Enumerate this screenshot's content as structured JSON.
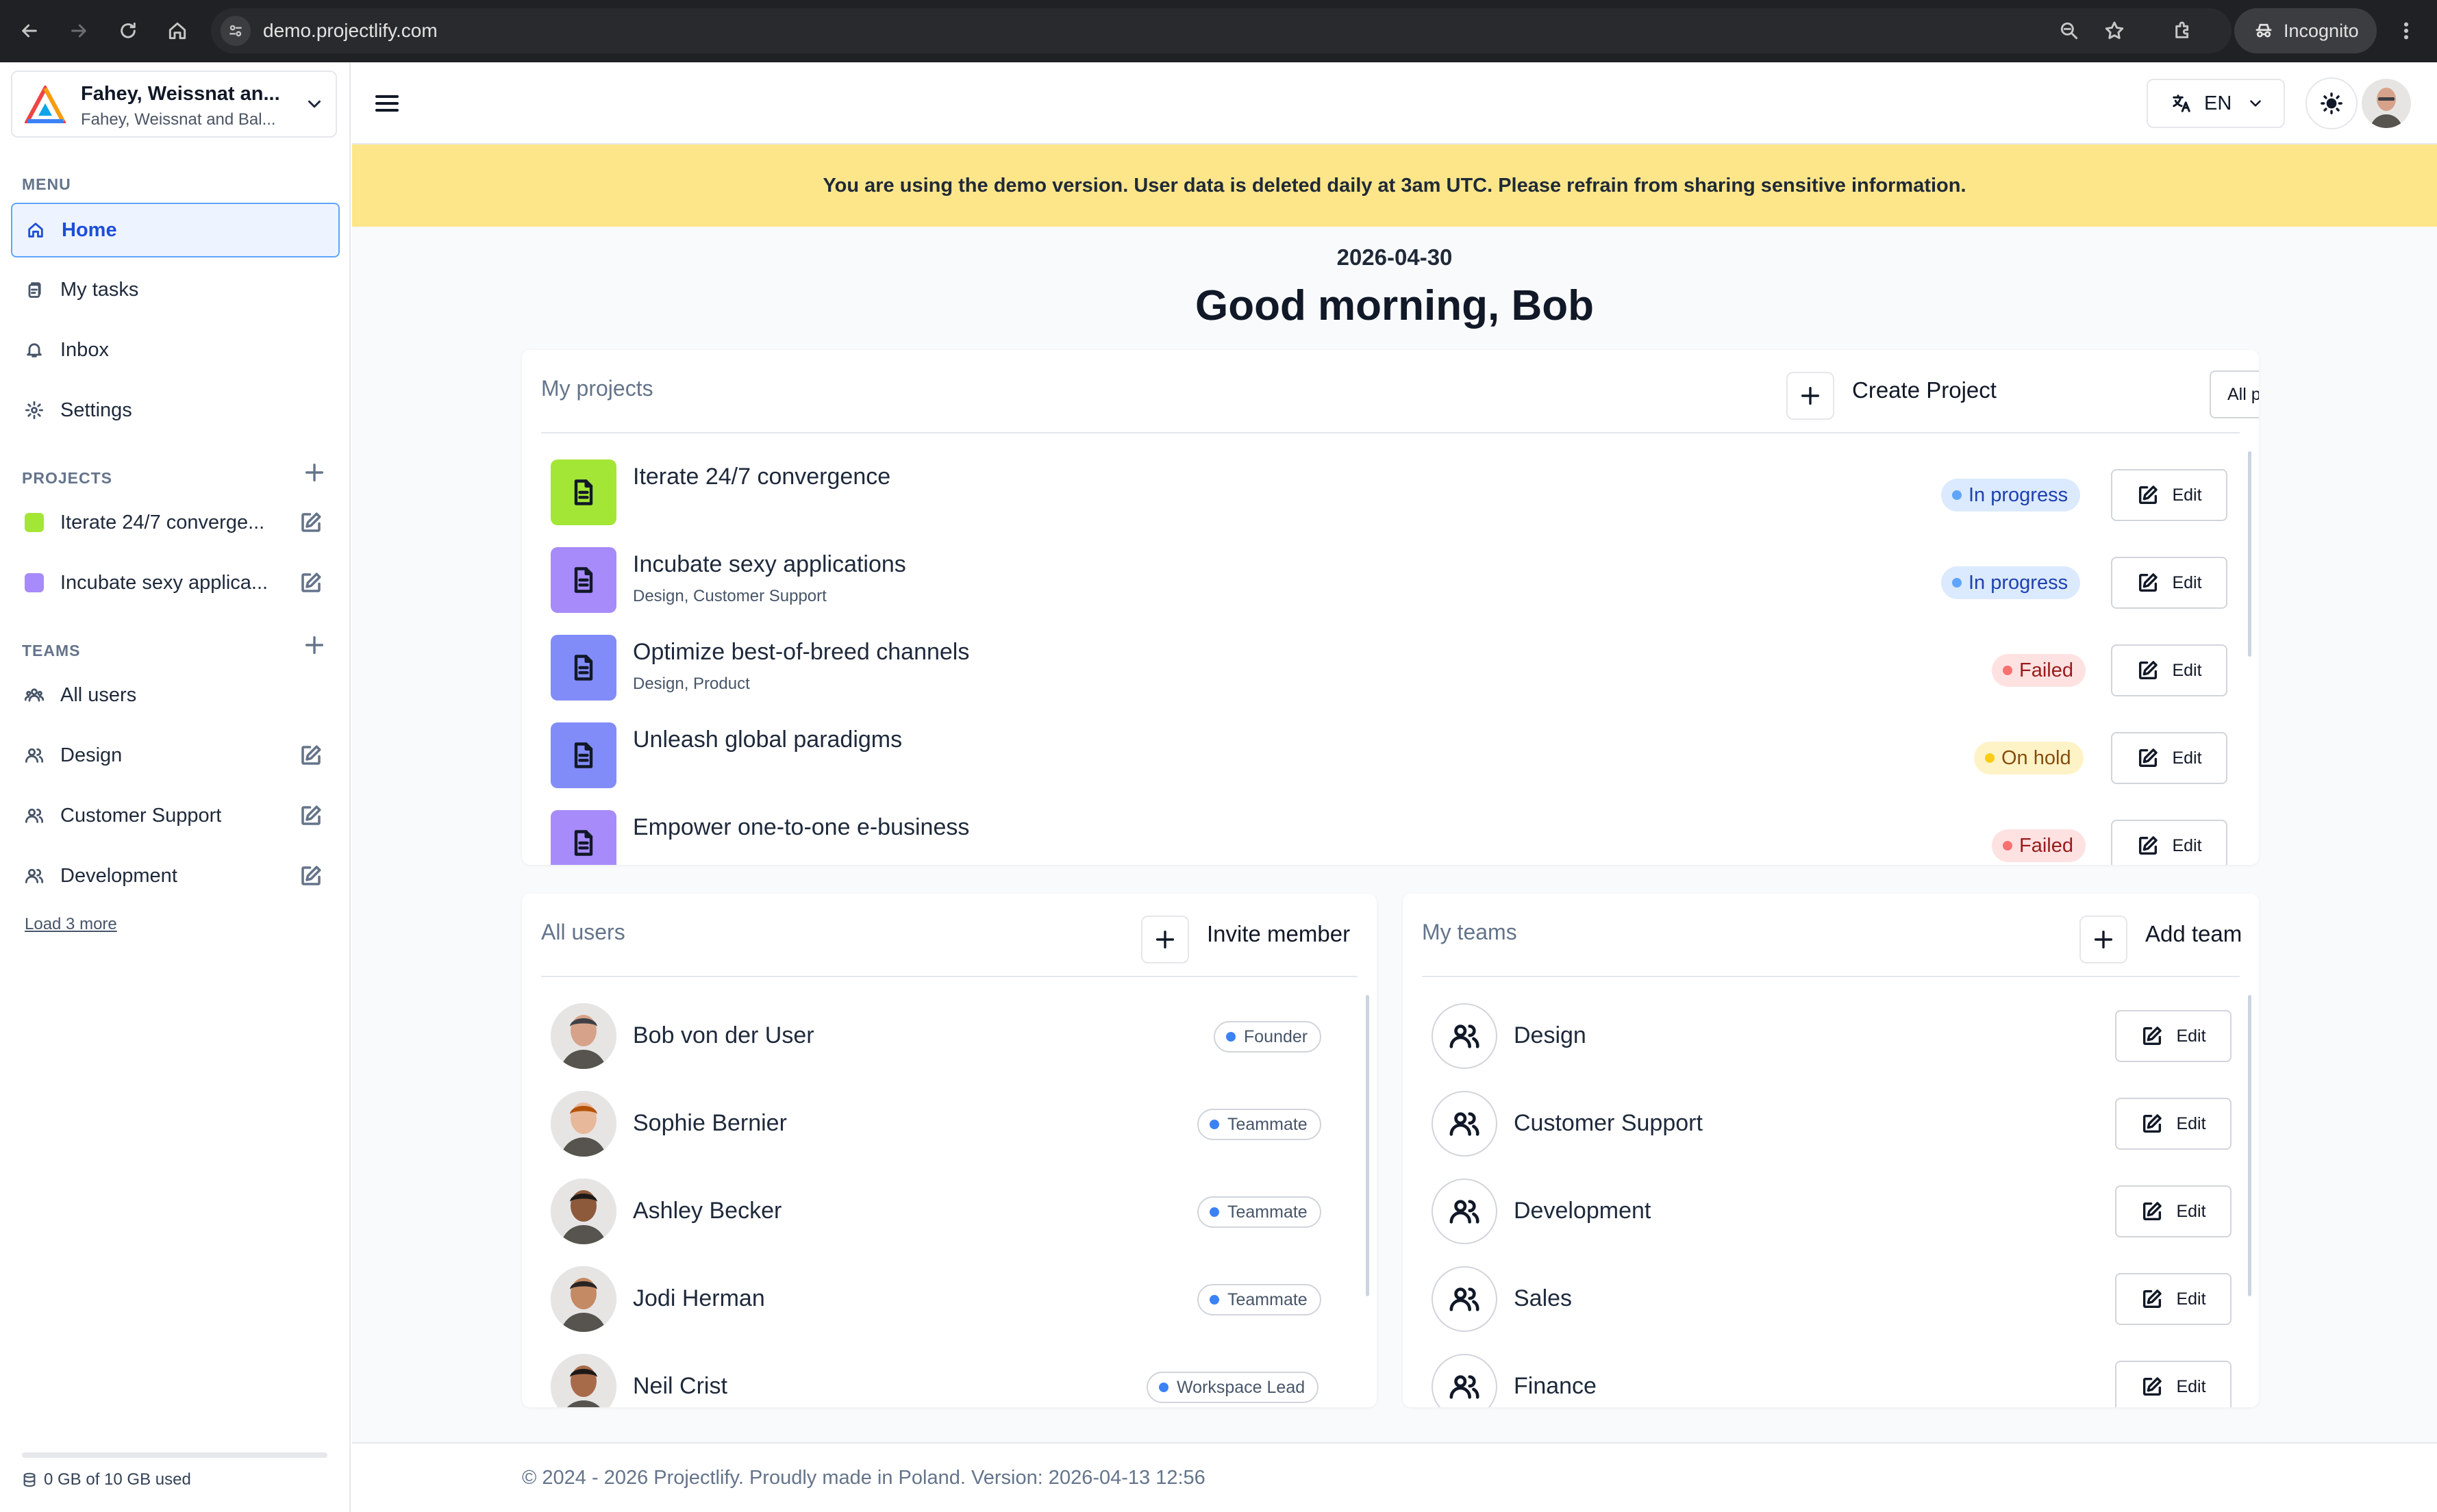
{
  "browser": {
    "url": "demo.projectlify.com",
    "incognito_label": "Incognito",
    "icons": [
      "back-icon",
      "forward-icon",
      "reload-icon",
      "home-icon",
      "site-info-icon",
      "zoom-icon",
      "bookmark-star-icon",
      "extensions-icon",
      "incognito-icon",
      "more-icon"
    ]
  },
  "workspace": {
    "name": "Fahey, Weissnat an...",
    "subname": "Fahey, Weissnat and Bal..."
  },
  "sidebar": {
    "menu_label": "MENU",
    "menu": [
      {
        "label": "Home",
        "icon": "home-icon",
        "active": true
      },
      {
        "label": "My tasks",
        "icon": "tasks-icon"
      },
      {
        "label": "Inbox",
        "icon": "bell-icon"
      },
      {
        "label": "Settings",
        "icon": "gear-icon"
      }
    ],
    "projects_label": "PROJECTS",
    "projects": [
      {
        "label": "Iterate 24/7 converge...",
        "color": "#a3e635"
      },
      {
        "label": "Incubate sexy applica...",
        "color": "#a78bfa"
      }
    ],
    "teams_label": "TEAMS",
    "teams": [
      {
        "label": "All users",
        "icon": "users-group-icon"
      },
      {
        "label": "Design",
        "icon": "users-icon"
      },
      {
        "label": "Customer Support",
        "icon": "users-icon"
      },
      {
        "label": "Development",
        "icon": "users-icon"
      }
    ],
    "load_more": "Load 3 more",
    "storage": "0 GB of 10 GB used",
    "storage_used_fraction": 0
  },
  "header": {
    "language": "EN"
  },
  "banner": "You are using the demo version. User data is deleted daily at 3am UTC. Please refrain from sharing sensitive information.",
  "main": {
    "date": "2026-04-30",
    "greeting": "Good morning, Bob"
  },
  "projects_card": {
    "title": "My projects",
    "create_label": "Create Project",
    "filter_value": "All projects",
    "edit_label": "Edit",
    "rows": [
      {
        "title": "Iterate 24/7 convergence",
        "sub": "",
        "status": "In progress",
        "kind": "progress",
        "color": "#a3e635"
      },
      {
        "title": "Incubate sexy applications",
        "sub": "Design, Customer Support",
        "status": "In progress",
        "kind": "progress",
        "color": "#a78bfa"
      },
      {
        "title": "Optimize best-of-breed channels",
        "sub": "Design, Product",
        "status": "Failed",
        "kind": "failed",
        "color": "#818cf8"
      },
      {
        "title": "Unleash global paradigms",
        "sub": "",
        "status": "On hold",
        "kind": "hold",
        "color": "#818cf8"
      },
      {
        "title": "Empower one-to-one e-business",
        "sub": "",
        "status": "Failed",
        "kind": "failed",
        "color": "#a78bfa"
      }
    ]
  },
  "users_card": {
    "title": "All users",
    "invite_label": "Invite member",
    "rows": [
      {
        "name": "Bob von der User",
        "role": "Founder"
      },
      {
        "name": "Sophie Bernier",
        "role": "Teammate"
      },
      {
        "name": "Ashley Becker",
        "role": "Teammate"
      },
      {
        "name": "Jodi Herman",
        "role": "Teammate"
      },
      {
        "name": "Neil Crist",
        "role": "Workspace Lead"
      }
    ]
  },
  "teams_card": {
    "title": "My teams",
    "add_label": "Add team",
    "edit_label": "Edit",
    "rows": [
      {
        "name": "Design"
      },
      {
        "name": "Customer Support"
      },
      {
        "name": "Development"
      },
      {
        "name": "Sales"
      },
      {
        "name": "Finance"
      }
    ]
  },
  "footer": "© 2024 - 2026 Projectlify. Proudly made in Poland. Version: 2026-04-13 12:56"
}
